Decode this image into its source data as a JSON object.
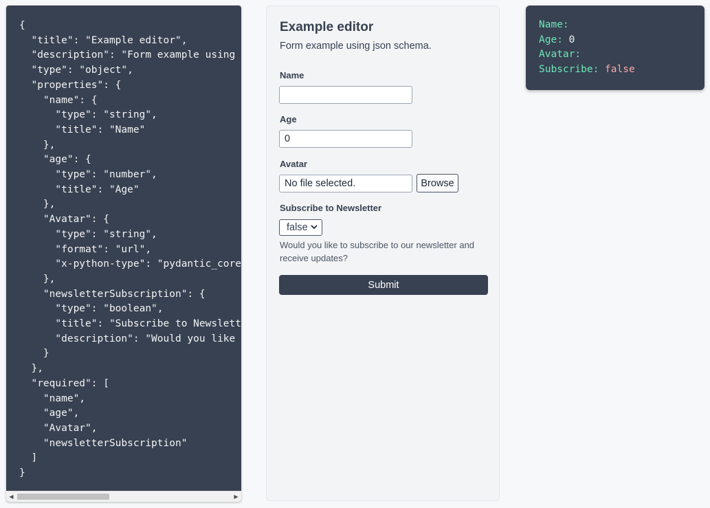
{
  "schema_code": "{\n  \"title\": \"Example editor\",\n  \"description\": \"Form example using json schema.\",\n  \"type\": \"object\",\n  \"properties\": {\n    \"name\": {\n      \"type\": \"string\",\n      \"title\": \"Name\"\n    },\n    \"age\": {\n      \"type\": \"number\",\n      \"title\": \"Age\"\n    },\n    \"Avatar\": {\n      \"type\": \"string\",\n      \"format\": \"url\",\n      \"x-python-type\": \"pydantic_core\n    },\n    \"newsletterSubscription\": {\n      \"type\": \"boolean\",\n      \"title\": \"Subscribe to Newslette\n      \"description\": \"Would you like t\n    }\n  },\n  \"required\": [\n    \"name\",\n    \"age\",\n    \"Avatar\",\n    \"newsletterSubscription\"\n  ]\n}",
  "form": {
    "title": "Example editor",
    "description": "Form example using json schema.",
    "name_label": "Name",
    "name_value": "",
    "age_label": "Age",
    "age_value": "0",
    "avatar_label": "Avatar",
    "avatar_value": "No file selected.",
    "browse_label": "Browse",
    "subscribe_label": "Subscribe to Newsletter",
    "subscribe_value": "false",
    "subscribe_help": "Would you like to subscribe to our newsletter and receive updates?",
    "submit_label": "Submit"
  },
  "output": {
    "name_key": "Name:",
    "name_value": "",
    "age_key": "Age:",
    "age_value": "0",
    "avatar_key": "Avatar:",
    "avatar_value": "",
    "subscribe_key": "Subscribe:",
    "subscribe_value": "false"
  },
  "colors": {
    "panel_dark": "#374151",
    "output_key": "#6ee7b7",
    "output_bool": "#f9a8a8",
    "background": "#f7f8fa"
  },
  "icons": [
    "chevron-left-icon",
    "chevron-right-icon",
    "chevron-down-icon"
  ]
}
